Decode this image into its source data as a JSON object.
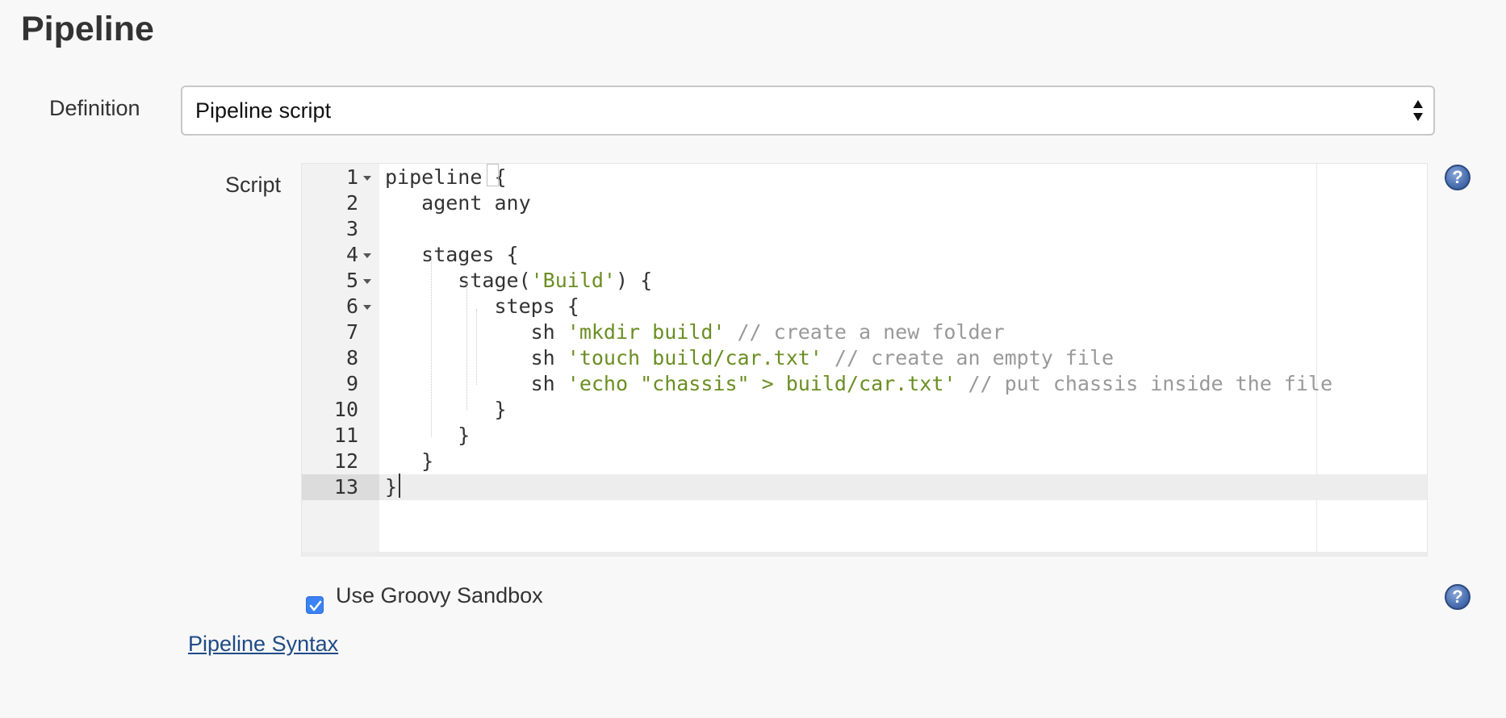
{
  "section": {
    "title": "Pipeline"
  },
  "definition": {
    "label": "Definition",
    "selected": "Pipeline script"
  },
  "script": {
    "label": "Script",
    "active_line": 13,
    "lines": [
      {
        "num": "1",
        "fold": true,
        "tokens": [
          {
            "t": "pipeline ",
            "k": "p"
          },
          {
            "t": "{",
            "k": "p"
          }
        ]
      },
      {
        "num": "2",
        "fold": false,
        "tokens": [
          {
            "t": "   agent any",
            "k": "p"
          }
        ]
      },
      {
        "num": "3",
        "fold": false,
        "tokens": []
      },
      {
        "num": "4",
        "fold": true,
        "tokens": [
          {
            "t": "   stages {",
            "k": "p"
          }
        ]
      },
      {
        "num": "5",
        "fold": true,
        "tokens": [
          {
            "t": "      stage(",
            "k": "p"
          },
          {
            "t": "'Build'",
            "k": "s"
          },
          {
            "t": ") {",
            "k": "p"
          }
        ]
      },
      {
        "num": "6",
        "fold": true,
        "tokens": [
          {
            "t": "         steps {",
            "k": "p"
          }
        ]
      },
      {
        "num": "7",
        "fold": false,
        "tokens": [
          {
            "t": "            sh ",
            "k": "p"
          },
          {
            "t": "'mkdir build'",
            "k": "s"
          },
          {
            "t": " // create a new folder",
            "k": "c"
          }
        ]
      },
      {
        "num": "8",
        "fold": false,
        "tokens": [
          {
            "t": "            sh ",
            "k": "p"
          },
          {
            "t": "'touch build/car.txt'",
            "k": "s"
          },
          {
            "t": " // create an empty file",
            "k": "c"
          }
        ]
      },
      {
        "num": "9",
        "fold": false,
        "tokens": [
          {
            "t": "            sh ",
            "k": "p"
          },
          {
            "t": "'echo \"chassis\" > build/car.txt'",
            "k": "s"
          },
          {
            "t": " // put chassis inside the file",
            "k": "c"
          }
        ]
      },
      {
        "num": "10",
        "fold": false,
        "tokens": [
          {
            "t": "         }",
            "k": "p"
          }
        ]
      },
      {
        "num": "11",
        "fold": false,
        "tokens": [
          {
            "t": "      }",
            "k": "p"
          }
        ]
      },
      {
        "num": "12",
        "fold": false,
        "tokens": [
          {
            "t": "   }",
            "k": "p"
          }
        ]
      },
      {
        "num": "13",
        "fold": false,
        "tokens": [
          {
            "t": "}",
            "k": "p"
          }
        ]
      }
    ]
  },
  "sandbox": {
    "label": "Use Groovy Sandbox",
    "checked": true
  },
  "syntax_link": {
    "label": "Pipeline Syntax"
  },
  "help": {
    "glyph": "?"
  },
  "colors": {
    "string": "#6b8e23",
    "comment": "#999999",
    "link": "#204a87",
    "checkbox": "#3b82f6"
  },
  "icons": {
    "select_arrows": "up-down-arrows-icon",
    "fold": "fold-triangle-icon",
    "help": "help-question-icon",
    "check": "checkmark-icon"
  }
}
